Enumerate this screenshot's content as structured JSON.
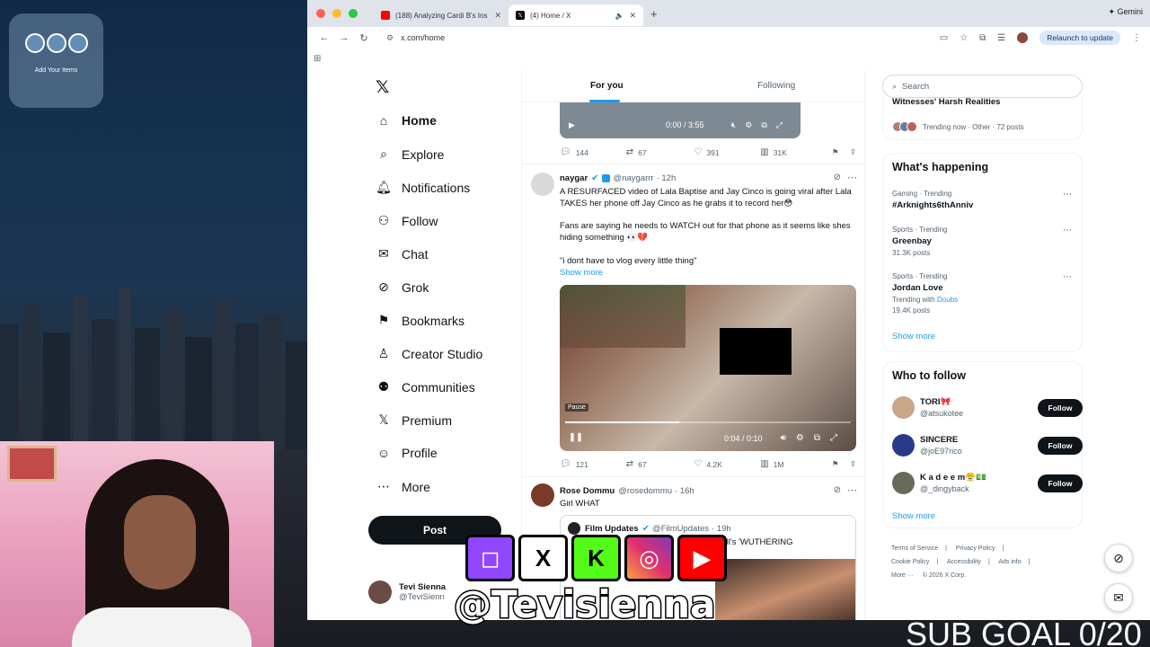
{
  "desktop": {
    "widget_label": "Add Your Items"
  },
  "browser": {
    "tabs": [
      {
        "title": "(188) Analyzing Cardi B's Ins",
        "active": false
      },
      {
        "title": "(4) Home / X",
        "active": true
      }
    ],
    "gemini_label": "Gemini",
    "url": "x.com/home",
    "relaunch_label": "Relaunch to update"
  },
  "x_nav": {
    "items": [
      {
        "label": "Home",
        "icon": "home-icon"
      },
      {
        "label": "Explore",
        "icon": "search-icon"
      },
      {
        "label": "Notifications",
        "icon": "bell-icon"
      },
      {
        "label": "Follow",
        "icon": "follow-icon"
      },
      {
        "label": "Chat",
        "icon": "mail-icon"
      },
      {
        "label": "Grok",
        "icon": "grok-icon"
      },
      {
        "label": "Bookmarks",
        "icon": "bookmark-icon"
      },
      {
        "label": "Creator Studio",
        "icon": "creator-icon"
      },
      {
        "label": "Communities",
        "icon": "communities-icon"
      },
      {
        "label": "Premium",
        "icon": "x-icon"
      },
      {
        "label": "Profile",
        "icon": "profile-icon"
      },
      {
        "label": "More",
        "icon": "more-icon"
      }
    ],
    "post_label": "Post",
    "profile": {
      "name": "Tevi Sienna",
      "handle": "@TeviSienn"
    }
  },
  "feed": {
    "tabs": [
      "For you",
      "Following"
    ],
    "video1": {
      "time": "0:00 / 3:55"
    },
    "video1_actions": {
      "replies": "144",
      "reposts": "67",
      "likes": "391",
      "views": "31K"
    },
    "tweet1": {
      "name": "naygar",
      "handle": "@naygarrr",
      "time": "· 12h",
      "text1": "A RESURFACED video of Lala Baptise and Jay Cinco is going viral after Lala TAKES her phone off Jay Cinco as he grabs it to record her😳",
      "text2": "Fans are saying he needs to WATCH out for that phone as it seems like shes hiding something 👀💔",
      "text3": "\"i dont have to vlog every little thing\"",
      "show_more": "Show more",
      "video": {
        "pause_label": "Pause",
        "time": "0:04 / 0:10",
        "progress": 0.4
      },
      "actions": {
        "replies": "121",
        "reposts": "67",
        "likes": "4.2K",
        "views": "1M"
      }
    },
    "tweet2": {
      "name": "Rose Dommu",
      "handle": "@rosedommu",
      "time": "· 16h",
      "text": "Girl WHAT",
      "quote": {
        "name": "Film Updates",
        "handle": "@FilmUpdates",
        "time": "· 19h",
        "text": "'d Fennell's 'WUTHERING"
      }
    }
  },
  "right": {
    "search_placeholder": "Search",
    "top_news": {
      "title": "Witnesses' Harsh Realities",
      "meta": "Trending now · Other · 72 posts"
    },
    "happening_title": "What's happening",
    "trends": [
      {
        "category": "Gaming · Trending",
        "name": "#Arknights6thAnniv",
        "sub": ""
      },
      {
        "category": "Sports · Trending",
        "name": "Greenbay",
        "sub": "31.3K posts"
      },
      {
        "category": "Sports · Trending",
        "name": "Jordan Love",
        "sub_prefix": "Trending with",
        "sub_link": "Doubs",
        "sub": "19.4K posts"
      }
    ],
    "show_more": "Show more",
    "who_title": "Who to follow",
    "who": [
      {
        "name": "TORI🎀",
        "handle": "@atsukotee",
        "button": "Follow",
        "avatar_color": "#c9a58a"
      },
      {
        "name": "SINCERE",
        "handle": "@joE97rico",
        "button": "Follow",
        "avatar_color": "#2a3a8a"
      },
      {
        "name": "K a d e e m😤💵",
        "handle": "@_dingyback",
        "button": "Follow",
        "avatar_color": "#6a6a5a"
      }
    ],
    "footer": [
      "Terms of Service",
      "|",
      "Privacy Policy",
      "|",
      "Cookie Policy",
      "|",
      "Accessibility",
      "|",
      "Ads info",
      "|",
      "More ···",
      "© 2026 X Corp."
    ]
  },
  "overlay": {
    "social_letters": [
      "",
      "X",
      "K",
      "",
      ""
    ],
    "handle": "@Tevisienna",
    "sub_goal": "SUB GOAL 0/20"
  }
}
